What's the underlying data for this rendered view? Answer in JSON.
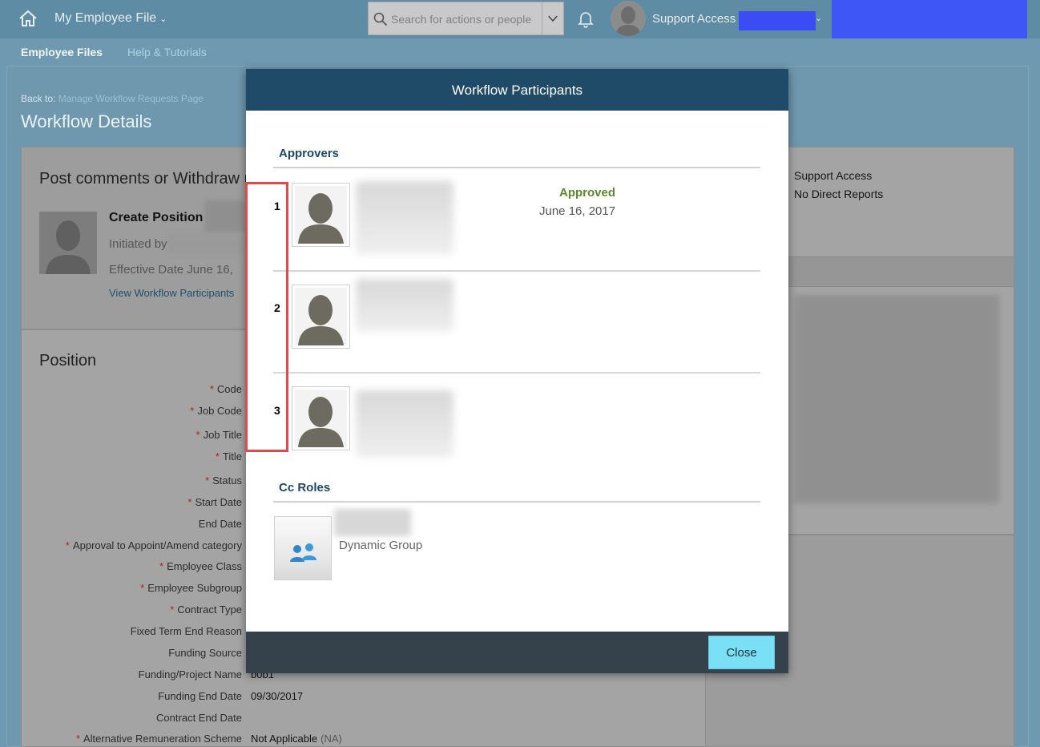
{
  "shell": {
    "app_title": "My Employee File",
    "search_placeholder": "Search for actions or people",
    "user_name": "Support Access"
  },
  "subnav": [
    "Employee Files",
    "Help & Tutorials"
  ],
  "page": {
    "back_label": "Back to:",
    "back_link": "Manage Workflow Requests Page",
    "title": "Workflow Details"
  },
  "comments_card": {
    "title": "Post comments or Withdraw r",
    "request_title": "Create Position",
    "initiated_by_label": "Initiated by",
    "effective_date": "Effective Date   June 16,",
    "participants_link": "View Workflow Participants"
  },
  "right_card": {
    "line1": "Support Access",
    "line2": "No Direct Reports"
  },
  "position": {
    "title": "Position",
    "fields": [
      {
        "label": "Code",
        "required": true,
        "value": ""
      },
      {
        "label": "Job Code",
        "required": true,
        "value": ""
      },
      {
        "label": "Job Title",
        "required": true,
        "value": ""
      },
      {
        "label": "Title",
        "required": true,
        "value": ""
      },
      {
        "label": "Status",
        "required": true,
        "value": ""
      },
      {
        "label": "Start Date",
        "required": true,
        "value": ""
      },
      {
        "label": "End Date",
        "required": false,
        "value": ""
      },
      {
        "label": "Approval to Appoint/Amend category",
        "required": true,
        "value": ""
      },
      {
        "label": "Employee Class",
        "required": true,
        "value": ""
      },
      {
        "label": "Employee Subgroup",
        "required": true,
        "value": ""
      },
      {
        "label": "Contract Type",
        "required": true,
        "value": ""
      },
      {
        "label": "Fixed Term End Reason",
        "required": false,
        "value": ""
      },
      {
        "label": "Funding Source",
        "required": false,
        "value": ""
      },
      {
        "label": "Funding/Project Name",
        "required": false,
        "value": "b0b1"
      },
      {
        "label": "Funding End Date",
        "required": false,
        "value": "09/30/2017"
      },
      {
        "label": "Contract End Date",
        "required": false,
        "value": ""
      },
      {
        "label": "Alternative Remuneration Scheme",
        "required": true,
        "value": "Not Applicable",
        "value_suffix": "(NA)"
      }
    ]
  },
  "dialog": {
    "title": "Workflow Participants",
    "approvers_heading": "Approvers",
    "approvers": [
      {
        "step": "1",
        "status": "Approved",
        "date": "June 16, 2017"
      },
      {
        "step": "2",
        "status": "",
        "date": ""
      },
      {
        "step": "3",
        "status": "",
        "date": ""
      }
    ],
    "cc_heading": "Cc Roles",
    "cc_group_label": "Dynamic Group",
    "close_label": "Close"
  },
  "colors": {
    "dialog_header": "#1f4b68",
    "approved_status": "#5a8a2a",
    "close_button": "#79e0f6",
    "highlight_box": "#e04a4a"
  }
}
